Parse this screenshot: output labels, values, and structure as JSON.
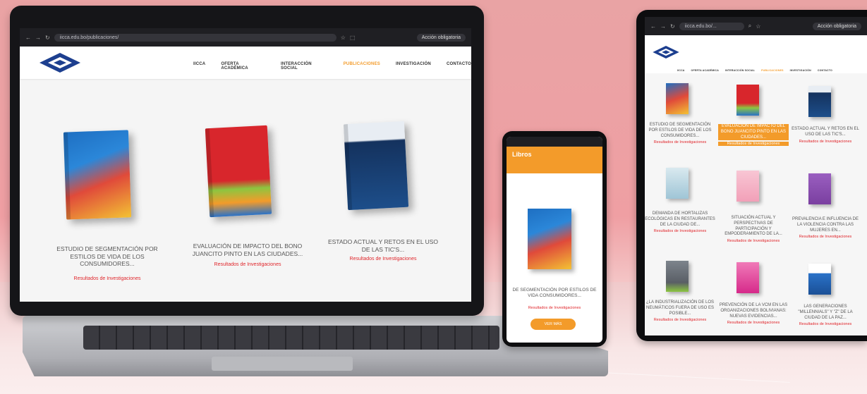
{
  "laptop": {
    "url": "iicca.edu.bo/publicaciones/",
    "action_label": "Acción obligatoria",
    "nav": [
      "IICCA",
      "OFERTA ACADÉMICA",
      "INTERACCIÓN SOCIAL",
      "PUBLICACIONES",
      "INVESTIGACIÓN",
      "CONTACTO"
    ],
    "active_nav": "PUBLICACIONES",
    "books": [
      {
        "title": "ESTUDIO DE SEGMENTACIÓN POR ESTILOS DE VIDA DE LOS CONSUMIDORES...",
        "category": "Resultados de Investigaciones",
        "cover": "#1e6fc2"
      },
      {
        "title": "EVALUACIÓN DE IMPACTO DEL BONO JUANCITO PINTO EN LAS CIUDADES...",
        "category": "Resultados de Investigaciones",
        "cover": "#d8262c"
      },
      {
        "title": "ESTADO ACTUAL Y RETOS EN EL USO DE LAS TIC'S...",
        "category": "Resultados de Investigaciones",
        "cover": "#14325e"
      }
    ]
  },
  "phone": {
    "header": "Libros",
    "book_title": "DE SEGMENTACIÓN POR ESTILOS DE VIDA CONSUMIDORES...",
    "category": "Resultados de Investigaciones",
    "button_label": "VER MÁS"
  },
  "tablet": {
    "url": "iicca.edu.bo/...",
    "action_label": "Acción obligatoria",
    "nav": [
      "IICCA",
      "OFERTA ACADÉMICA",
      "INTERACCIÓN SOCIAL",
      "PUBLICACIONES",
      "INVESTIGACIÓN",
      "CONTACTO"
    ],
    "active_nav": "PUBLICACIONES",
    "items": [
      {
        "title": "ESTUDIO DE SEGMENTACIÓN POR ESTILOS DE VIDA DE LOS CONSUMIDORES...",
        "category": "Resultados de Investigaciones",
        "cover": "#1e6fc2"
      },
      {
        "title": "EVALUACIÓN DE IMPACTO DEL BONO JUANCITO PINTO EN LAS CIUDADES...",
        "category": "Resultados de Investigaciones",
        "cover": "#d8262c",
        "highlight": true
      },
      {
        "title": "ESTADO ACTUAL Y RETOS EN EL USO DE LAS TIC'S...",
        "category": "Resultados de Investigaciones",
        "cover": "#14325e"
      },
      {
        "title": "DEMANDA DE HORTALIZAS ECOLÓGICAS EN RESTAURANTES DE LA CIUDAD DE...",
        "category": "Resultados de Investigaciones",
        "cover": "#9fc5d6"
      },
      {
        "title": "SITUACIÓN ACTUAL Y PERSPECTIVAS DE PARTICIPACIÓN Y EMPODERAMIENTO DE LA...",
        "category": "Resultados de Investigaciones",
        "cover": "#f2a0b8"
      },
      {
        "title": "PREVALENCIA E INFLUENCIA DE LA VIOLENCIA CONTRA LAS MUJERES EN...",
        "category": "Resultados de Investigaciones",
        "cover": "#7a3fa0"
      },
      {
        "title": "¿LA INDUSTRIALIZACIÓN DE LOS NEUMÁTICOS FUERA DE USO ES POSIBLE...",
        "category": "Resultados de Investigaciones",
        "cover": "#5a5f66"
      },
      {
        "title": "PREVENCIÓN DE LA VCM EN LAS ORGANIZACIONES BOLIVIANAS: NUEVAS EVIDENCIAS...",
        "category": "Resultados de Investigaciones",
        "cover": "#d62a8a"
      },
      {
        "title": "LAS GENERACIONES \"MILLENNIALS\" Y \"Z\" DE LA CIUDAD DE LA PAZ...",
        "category": "Resultados de Investigaciones",
        "cover": "#2a72c8"
      }
    ]
  },
  "colors": {
    "accent": "#f39b2a",
    "category": "#e0262b",
    "logo": "#1d3f8f",
    "background": "#ef9fa3"
  }
}
